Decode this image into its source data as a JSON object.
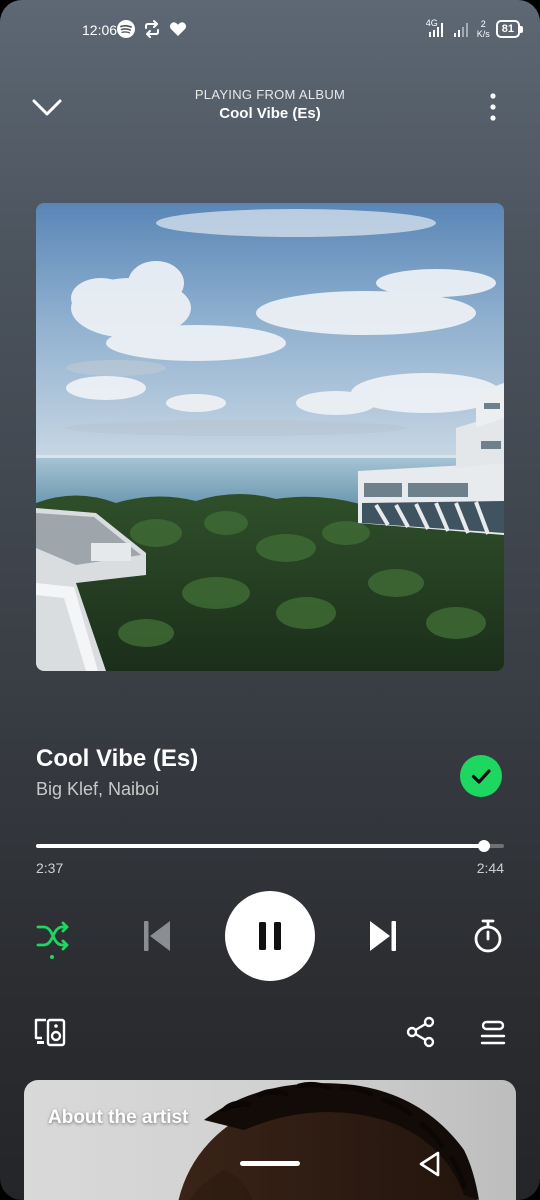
{
  "status_bar": {
    "time": "12:06",
    "network_label": "4G",
    "speed_value": "2",
    "speed_unit": "K/s",
    "battery": "81"
  },
  "header": {
    "context_label": "PLAYING FROM ALBUM",
    "album_name": "Cool Vibe (Es)"
  },
  "track": {
    "title": "Cool Vibe (Es)",
    "artists": "Big Klef, Naiboi",
    "saved": true
  },
  "playback": {
    "elapsed": "2:37",
    "total": "2:44",
    "progress_fraction": 0.957,
    "is_playing": true,
    "shuffle_on": true
  },
  "about_card": {
    "title": "About the artist"
  },
  "icons": {
    "collapse": "chevron-down-icon",
    "more": "more-vertical-icon",
    "shuffle": "shuffle-icon",
    "previous": "skip-previous-icon",
    "pause": "pause-icon",
    "next": "skip-next-icon",
    "sleep_timer": "timer-icon",
    "devices": "connect-device-icon",
    "share": "share-icon",
    "queue": "queue-icon",
    "back": "back-triangle-icon"
  },
  "colors": {
    "accent": "#1ed760",
    "disabled": "#8a8d92"
  }
}
